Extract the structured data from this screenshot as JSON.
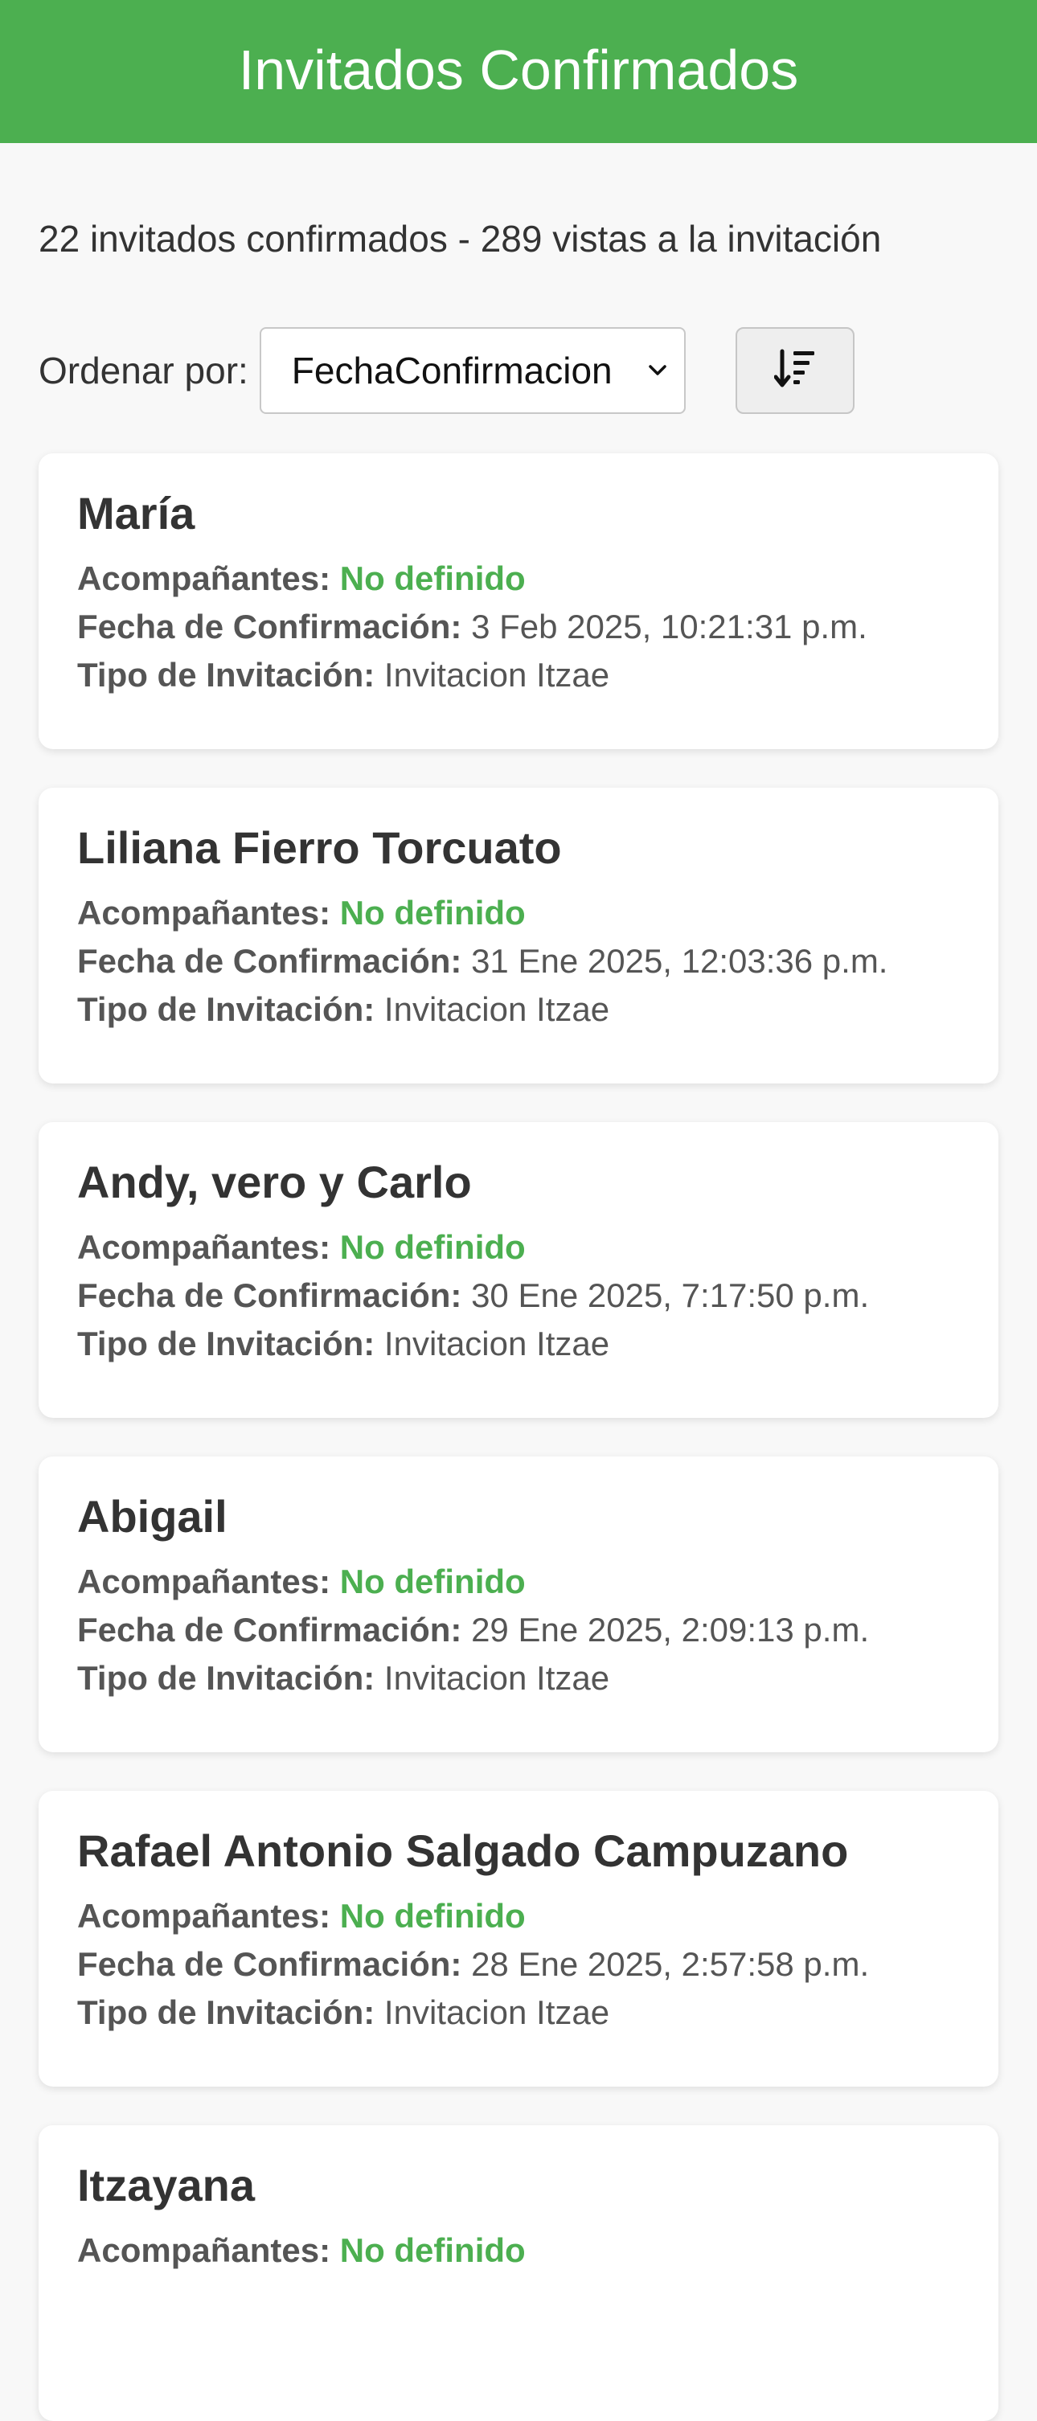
{
  "header": {
    "title": "Invitados Confirmados",
    "color": "#4caf50"
  },
  "summary": {
    "text": "22 invitados confirmados - 289 vistas a la invitación"
  },
  "sort": {
    "label": "Ordenar por:",
    "selected": "FechaConfirmacion",
    "order_icon": "sort-descending-icon"
  },
  "labels": {
    "companions": "Acompañantes:",
    "date": "Fecha de Confirmación:",
    "type": "Tipo de Invitación:"
  },
  "guests": [
    {
      "name": "María",
      "companions": "No definido",
      "date": "3 Feb 2025, 10:21:31 p.m.",
      "type": "Invitacion Itzae"
    },
    {
      "name": "Liliana Fierro Torcuato",
      "companions": "No definido",
      "date": "31 Ene 2025, 12:03:36 p.m.",
      "type": "Invitacion Itzae"
    },
    {
      "name": "Andy, vero y Carlo",
      "companions": "No definido",
      "date": "30 Ene 2025, 7:17:50 p.m.",
      "type": "Invitacion Itzae"
    },
    {
      "name": "Abigail",
      "companions": "No definido",
      "date": "29 Ene 2025, 2:09:13 p.m.",
      "type": "Invitacion Itzae"
    },
    {
      "name": "Rafael Antonio Salgado Campuzano",
      "companions": "No definido",
      "date": "28 Ene 2025, 2:57:58 p.m.",
      "type": "Invitacion Itzae"
    },
    {
      "name": "Itzayana",
      "companions": "No definido",
      "date": "",
      "type": ""
    }
  ]
}
